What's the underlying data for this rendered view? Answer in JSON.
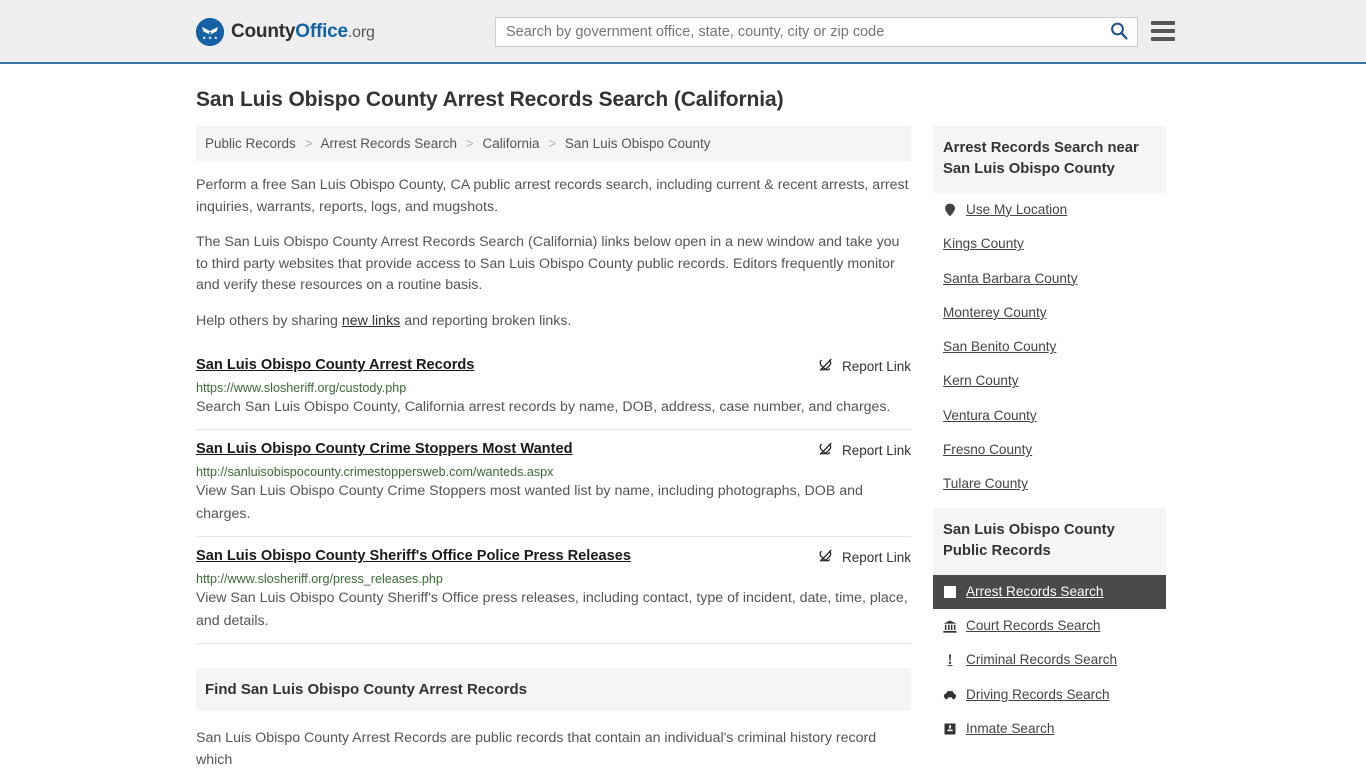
{
  "header": {
    "logo_name": "County",
    "logo_bold": "Office",
    "logo_tld": ".org",
    "logo_icon": "eagle-shield-icon",
    "search_placeholder": "Search by government office, state, county, city or zip code",
    "search_value": "",
    "search_icon": "search-icon",
    "menu_icon": "hamburger-menu-icon"
  },
  "page": {
    "title": "San Luis Obispo County Arrest Records Search (California)"
  },
  "breadcrumb": {
    "separator": ">",
    "items": [
      {
        "label": "Public Records"
      },
      {
        "label": "Arrest Records Search"
      },
      {
        "label": "California"
      },
      {
        "label": "San Luis Obispo County"
      }
    ]
  },
  "intro": {
    "p1": "Perform a free San Luis Obispo County, CA public arrest records search, including current & recent arrests, arrest inquiries, warrants, reports, logs, and mugshots.",
    "p2": "The San Luis Obispo County Arrest Records Search (California) links below open in a new window and take you to third party websites that provide access to San Luis Obispo County public records. Editors frequently monitor and verify these resources on a routine basis.",
    "p3_before": "Help others by sharing ",
    "p3_link": "new links",
    "p3_after": " and reporting broken links."
  },
  "report_link_label": "Report Link",
  "report_link_icon": "broken-link-icon",
  "results": [
    {
      "title": "San Luis Obispo County Arrest Records",
      "url": "https://www.slosheriff.org/custody.php",
      "description": "Search San Luis Obispo County, California arrest records by name, DOB, address, case number, and charges."
    },
    {
      "title": "San Luis Obispo County Crime Stoppers Most Wanted",
      "url": "http://sanluisobispocounty.crimestoppersweb.com/wanteds.aspx",
      "description": "View San Luis Obispo County Crime Stoppers most wanted list by name, including photographs, DOB and charges."
    },
    {
      "title": "San Luis Obispo County Sheriff's Office Police Press Releases",
      "url": "http://www.slosheriff.org/press_releases.php",
      "description": "View San Luis Obispo County Sheriff's Office press releases, including contact, type of incident, date, time, place, and details."
    }
  ],
  "find_section": {
    "heading": "Find San Luis Obispo County Arrest Records",
    "body": "San Luis Obispo County Arrest Records are public records that contain an individual's criminal history record which"
  },
  "sidebar": {
    "near_box": {
      "heading": "Arrest Records Search near San Luis Obispo County",
      "items": [
        {
          "label": "Use My Location",
          "icon": "map-pin-icon"
        },
        {
          "label": "Kings County",
          "icon": "none"
        },
        {
          "label": "Santa Barbara County",
          "icon": "none"
        },
        {
          "label": "Monterey County",
          "icon": "none"
        },
        {
          "label": "San Benito County",
          "icon": "none"
        },
        {
          "label": "Kern County",
          "icon": "none"
        },
        {
          "label": "Ventura County",
          "icon": "none"
        },
        {
          "label": "Fresno County",
          "icon": "none"
        },
        {
          "label": "Tulare County",
          "icon": "none"
        }
      ]
    },
    "records_box": {
      "heading": "San Luis Obispo County Public Records",
      "items": [
        {
          "label": "Arrest Records Search",
          "icon": "arrest-record-icon",
          "active": true
        },
        {
          "label": "Court Records Search",
          "icon": "courthouse-icon",
          "active": false
        },
        {
          "label": "Criminal Records Search",
          "icon": "exclamation-icon",
          "active": false
        },
        {
          "label": "Driving Records Search",
          "icon": "car-icon",
          "active": false
        },
        {
          "label": "Inmate Search",
          "icon": "inmate-icon",
          "active": false
        }
      ]
    }
  },
  "colors": {
    "brand_blue": "#1462a5",
    "header_bg": "#eeeeee",
    "header_border": "#3a76ab",
    "panel_bg": "#f5f5f5",
    "url_green": "#3a6b35",
    "active_bg": "#4a4a4a",
    "body_text": "#555555"
  }
}
